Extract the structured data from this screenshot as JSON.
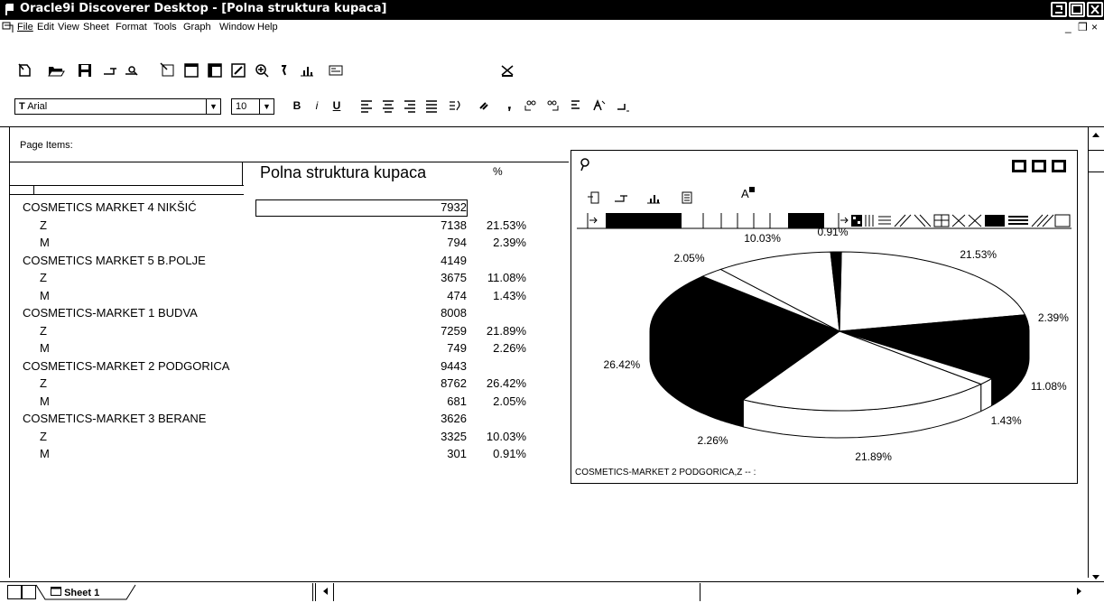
{
  "window": {
    "title": "Oracle9i Discoverer Desktop - [Polna struktura kupaca]"
  },
  "menu": {
    "items": [
      "File",
      "Edit",
      "View",
      "Sheet",
      "Format",
      "Tools",
      "Graph",
      "Window",
      "Help"
    ],
    "mdi_controls": [
      "_",
      "❒",
      "×"
    ]
  },
  "format_bar": {
    "font": "Arial",
    "size": "10",
    "bold": "B",
    "italic": "і",
    "underline": "U"
  },
  "worksheet": {
    "page_items_label": "Page Items:",
    "title": "Polna struktura kupaca",
    "pct_header": "%",
    "rows": [
      {
        "label": "COSMETICS MARKET 4 NIKŠIĆ",
        "value": "7932",
        "pct": "",
        "level": 0
      },
      {
        "label": "Z",
        "value": "7138",
        "pct": "21.53%",
        "level": 1
      },
      {
        "label": "M",
        "value": "794",
        "pct": "2.39%",
        "level": 1
      },
      {
        "label": "COSMETICS MARKET 5 B.POLJE",
        "value": "4149",
        "pct": "",
        "level": 0
      },
      {
        "label": "Z",
        "value": "3675",
        "pct": "11.08%",
        "level": 1
      },
      {
        "label": "M",
        "value": "474",
        "pct": "1.43%",
        "level": 1
      },
      {
        "label": "COSMETICS-MARKET 1 BUDVA",
        "value": "8008",
        "pct": "",
        "level": 0
      },
      {
        "label": "Z",
        "value": "7259",
        "pct": "21.89%",
        "level": 1
      },
      {
        "label": "M",
        "value": "749",
        "pct": "2.26%",
        "level": 1
      },
      {
        "label": "COSMETICS-MARKET 2 PODGORICA",
        "value": "9443",
        "pct": "",
        "level": 0
      },
      {
        "label": "Z",
        "value": "8762",
        "pct": "26.42%",
        "level": 1
      },
      {
        "label": "M",
        "value": "681",
        "pct": "2.05%",
        "level": 1
      },
      {
        "label": "COSMETICS-MARKET 3 BERANE",
        "value": "3626",
        "pct": "",
        "level": 0
      },
      {
        "label": "Z",
        "value": "3325",
        "pct": "10.03%",
        "level": 1
      },
      {
        "label": "M",
        "value": "301",
        "pct": "0.91%",
        "level": 1
      }
    ]
  },
  "graph": {
    "footer": "COSMETICS-MARKET 2 PODGORICA,Z -- :",
    "toolbar_icon": "A"
  },
  "chart_data": {
    "type": "pie",
    "categories": [
      "COSMETICS MARKET 4 NIKŠIĆ Z",
      "COSMETICS MARKET 4 NIKŠIĆ M",
      "COSMETICS MARKET 5 B.POLJE Z",
      "COSMETICS MARKET 5 B.POLJE M",
      "COSMETICS-MARKET 1 BUDVA Z",
      "COSMETICS-MARKET 1 BUDVA M",
      "COSMETICS-MARKET 2 PODGORICA Z",
      "COSMETICS-MARKET 2 PODGORICA M",
      "COSMETICS-MARKET 3 BERANE Z",
      "COSMETICS-MARKET 3 BERANE M"
    ],
    "values": [
      21.53,
      2.39,
      11.08,
      1.43,
      21.89,
      2.26,
      26.42,
      2.05,
      10.03,
      0.91
    ],
    "labels": [
      "21.53%",
      "2.39%",
      "11.08%",
      "1.43%",
      "21.89%",
      "2.26%",
      "26.42%",
      "2.05%",
      "10.03%",
      "0.91%"
    ],
    "colors": [
      "#ffffff",
      "#000000",
      "#000000",
      "#ffffff",
      "#ffffff",
      "#000000",
      "#000000",
      "#ffffff",
      "#ffffff",
      "#000000"
    ]
  },
  "sheet_tabs": {
    "tabs": [
      "Sheet 1"
    ]
  },
  "colors": {
    "titlebar": "#000000",
    "background": "#ffffff"
  }
}
